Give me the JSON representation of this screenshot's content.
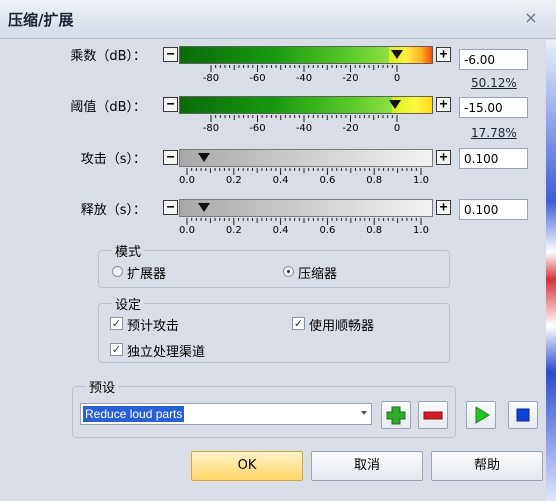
{
  "window": {
    "title": "压缩/扩展",
    "close_glyph": "×"
  },
  "rows": [
    {
      "id": "gain",
      "label": "乘数（dB）：",
      "value": "-6.00",
      "percent": "50.12%",
      "thumb_fraction": 0.86,
      "ticks": [
        "-80",
        "-60",
        "-40",
        "-20",
        "0"
      ]
    },
    {
      "id": "threshold",
      "label": "阈值（dB）：",
      "value": "-15.00",
      "percent": "17.78%",
      "thumb_fraction": 0.85,
      "ticks": [
        "-80",
        "-60",
        "-40",
        "-20",
        "0"
      ]
    },
    {
      "id": "attack",
      "label": "攻击（s）：",
      "value": "0.100",
      "thumb_fraction": 0.1,
      "ticks": [
        "0.0",
        "0.2",
        "0.4",
        "0.6",
        "0.8",
        "1.0"
      ]
    },
    {
      "id": "release",
      "label": "释放（s）：",
      "value": "0.100",
      "thumb_fraction": 0.1,
      "ticks": [
        "0.0",
        "0.2",
        "0.4",
        "0.6",
        "0.8",
        "1.0"
      ]
    }
  ],
  "minus_glyph": "−",
  "plus_glyph": "+",
  "mode": {
    "title": "模式",
    "options": [
      {
        "label": "扩展器",
        "selected": false
      },
      {
        "label": "压缩器",
        "selected": true
      }
    ]
  },
  "settings": {
    "title": "设定",
    "checkboxes": [
      {
        "label": "预计攻击",
        "checked": true
      },
      {
        "label": "使用顺畅器",
        "checked": true
      },
      {
        "label": "独立处理渠道",
        "checked": true
      }
    ],
    "check_glyph": "✓"
  },
  "preset": {
    "title": "预设",
    "selected": "Reduce loud parts"
  },
  "toolbar": {
    "add": "add-icon",
    "remove": "remove-icon",
    "play": "play-icon",
    "stop": "stop-icon"
  },
  "buttons": {
    "ok": "OK",
    "cancel": "取消",
    "help": "帮助"
  },
  "colors": {
    "accent": "#2a5fd6",
    "ok_button": "#ffd668",
    "add": "#2fa82c",
    "remove": "#d81a28",
    "play": "#28c028",
    "stop": "#1040d8"
  }
}
